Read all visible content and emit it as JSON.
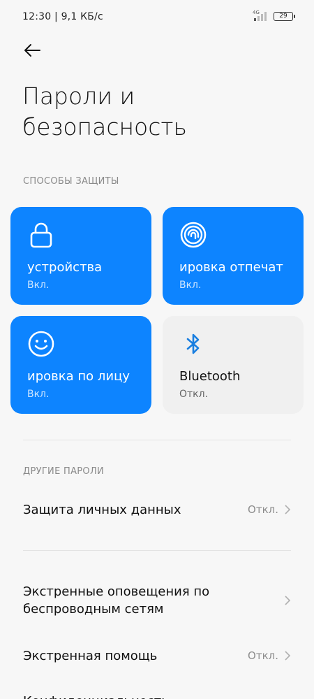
{
  "status": {
    "time_speed": "12:30 | 9,1 КБ/с",
    "network": "4G",
    "battery": "29"
  },
  "header": {
    "title": "Пароли и безопасность"
  },
  "sections": {
    "protection": "СПОСОБЫ ЗАЩИТЫ",
    "other": "ДРУГИЕ ПАРОЛИ"
  },
  "tiles": [
    {
      "title": "устройства",
      "status": "Вкл.",
      "icon": "lock-icon",
      "active": true
    },
    {
      "title": "ировка отпечат",
      "status": "Вкл.",
      "icon": "fingerprint-icon",
      "active": true
    },
    {
      "title": "ировка по лицу",
      "status": "Вкл.",
      "icon": "face-icon",
      "active": true
    },
    {
      "title": "Bluetooth",
      "status": "Откл.",
      "icon": "bluetooth-icon",
      "active": false
    }
  ],
  "rows": [
    {
      "title": "Защита личных данных",
      "value": "Откл."
    },
    {
      "title": "Экстренные оповещения по беспроводным сетям",
      "value": ""
    },
    {
      "title": "Экстренная помощь",
      "value": "Откл."
    },
    {
      "title": "Конфиденциальность",
      "value": ""
    }
  ],
  "colors": {
    "accent": "#0d84ff",
    "inactive_tile": "#f0f0f0",
    "background": "#f7f7f7"
  }
}
